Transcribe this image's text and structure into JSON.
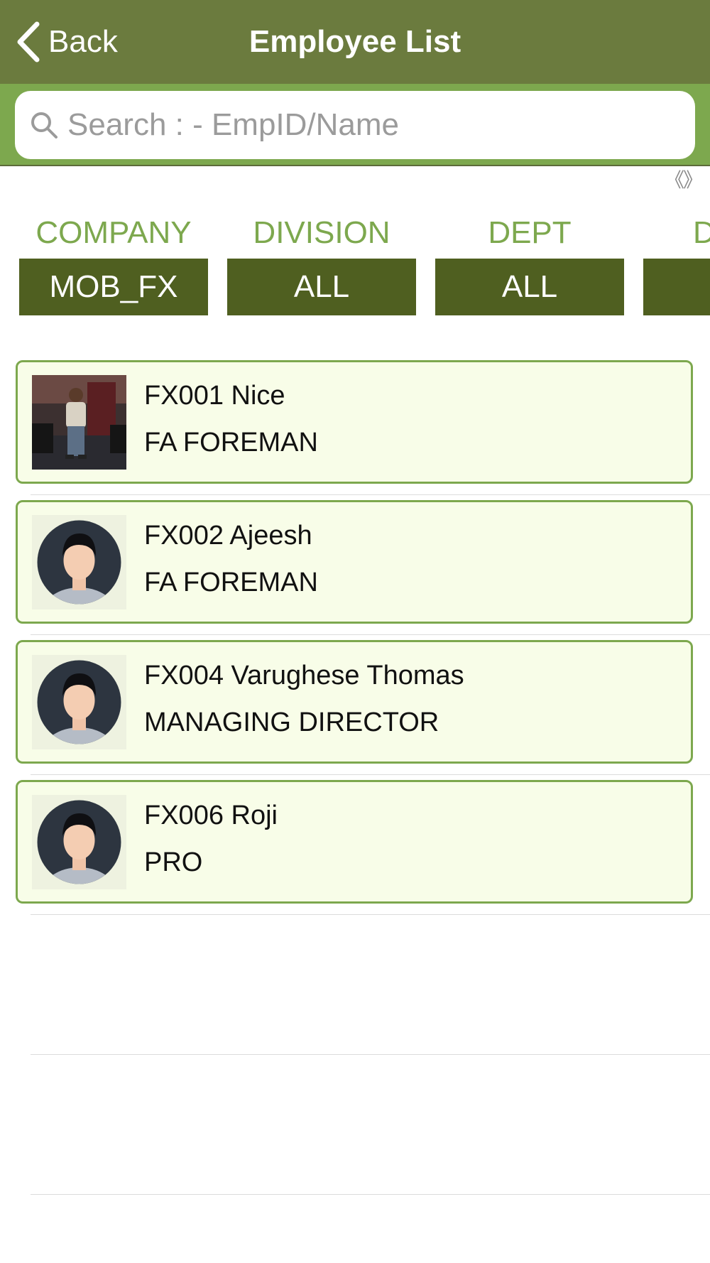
{
  "header": {
    "back_label": "Back",
    "title": "Employee List",
    "back_icon": "chevron-left-icon",
    "bar_color": "#6b7b3e"
  },
  "search": {
    "placeholder": "Search : - EmpID/Name",
    "value": "",
    "icon": "search-icon",
    "bar_color": "#7da84e"
  },
  "scroll_hint": {
    "icon": "double-chevron-icon",
    "text": "《》"
  },
  "filters": [
    {
      "label": "COMPANY",
      "value": "MOB_FX"
    },
    {
      "label": "DIVISION",
      "value": "ALL"
    },
    {
      "label": "DEPT",
      "value": "ALL"
    },
    {
      "label": "D",
      "value": ""
    }
  ],
  "filter_colors": {
    "label": "#7da84e",
    "button": "#4f5f20"
  },
  "employees": [
    {
      "line1": "FX001 Nice",
      "line2": "FA FOREMAN",
      "photo": "employee-photo"
    },
    {
      "line1": "FX002 Ajeesh",
      "line2": "FA FOREMAN",
      "photo": "default-avatar-icon"
    },
    {
      "line1": "FX004 Varughese Thomas",
      "line2": "MANAGING DIRECTOR",
      "photo": "default-avatar-icon"
    },
    {
      "line1": "FX006 Roji",
      "line2": "PRO",
      "photo": "default-avatar-icon"
    }
  ],
  "card_colors": {
    "background": "#f8fde8",
    "border": "#7da84e"
  }
}
